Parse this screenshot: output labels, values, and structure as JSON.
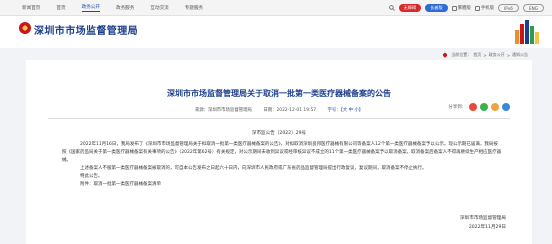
{
  "topbar": {
    "nav": [
      "新闻首页",
      "首页",
      "政务公开",
      "政务服务",
      "互动交流",
      "专题服务"
    ],
    "active_index": 2,
    "pill_red": "无障碍",
    "pill_blue": "长者版",
    "tools": [
      "繁體版",
      "手机版"
    ],
    "pill_outline": "IPv6",
    "pill_outline2": "ENG"
  },
  "header": {
    "site_title": "深圳市市场监督管理局"
  },
  "breadcrumb": {
    "items": [
      "当前位置：",
      "首页",
      ">",
      "政务公开",
      ">",
      "通知公告"
    ]
  },
  "article": {
    "title": "深圳市市场监督管理局关于取消一批第一类医疗器械备案的公告",
    "source": "来源：深圳市市场监督管理局",
    "date": "日期：2022-12-01 19:57",
    "font_size": "字号：【大 中 小】",
    "share_label": "分享到：",
    "doc_number": "深市监公告〔2022〕29号",
    "paragraphs": [
      "2022年11月16日，我局发布了《深圳市市场监督管理局关于拟取消一批第一类医疗器械备案的公告》，对拟取消深圳良邦医疗器械有限公司等备案人12个第一类医疗器械备案予以公示。现公示期已届满，我局按照《国家药监局关于第一类医疗器械备案有关事项的公告》（2022年第62号）有关规定，对公示期间未收到异议或经审核异议不成立的11个第一类医疗器械备案予以取消备案，取消备案后备案人不得再继续生产相应医疗器械。",
      "上述备案人不服第一类医疗器械备案被取消的，可自本公告发布之日起六十日内，向深圳市人民政府或广东省药品监督管理局提出行政复议，复议期间，取消备案不停止执行。",
      "特此公告。",
      "附件：取消一批第一类医疗器械备案清单"
    ],
    "signature": "深圳市市场监督管理局",
    "sign_date": "2022年11月29日"
  }
}
